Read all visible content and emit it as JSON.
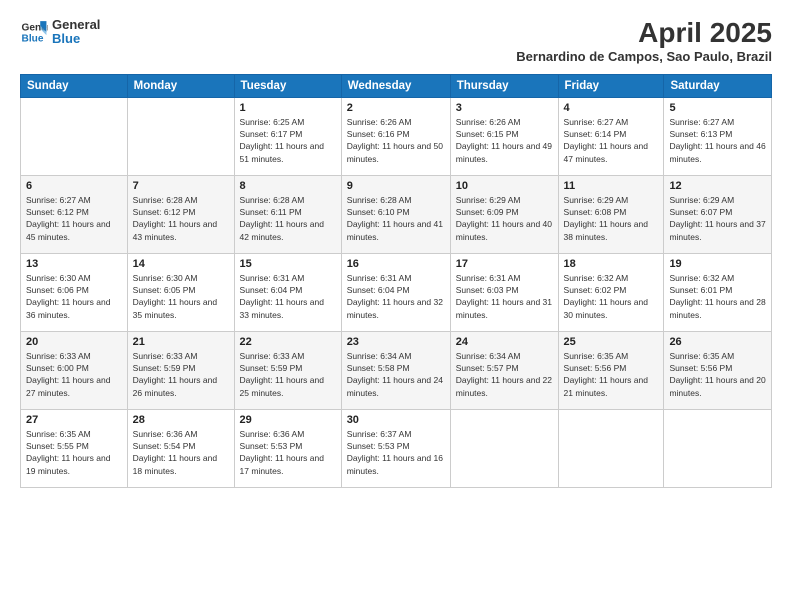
{
  "logo": {
    "line1": "General",
    "line2": "Blue"
  },
  "title": "April 2025",
  "subtitle": "Bernardino de Campos, Sao Paulo, Brazil",
  "days_of_week": [
    "Sunday",
    "Monday",
    "Tuesday",
    "Wednesday",
    "Thursday",
    "Friday",
    "Saturday"
  ],
  "weeks": [
    [
      {
        "day": "",
        "info": ""
      },
      {
        "day": "",
        "info": ""
      },
      {
        "day": "1",
        "info": "Sunrise: 6:25 AM\nSunset: 6:17 PM\nDaylight: 11 hours and 51 minutes."
      },
      {
        "day": "2",
        "info": "Sunrise: 6:26 AM\nSunset: 6:16 PM\nDaylight: 11 hours and 50 minutes."
      },
      {
        "day": "3",
        "info": "Sunrise: 6:26 AM\nSunset: 6:15 PM\nDaylight: 11 hours and 49 minutes."
      },
      {
        "day": "4",
        "info": "Sunrise: 6:27 AM\nSunset: 6:14 PM\nDaylight: 11 hours and 47 minutes."
      },
      {
        "day": "5",
        "info": "Sunrise: 6:27 AM\nSunset: 6:13 PM\nDaylight: 11 hours and 46 minutes."
      }
    ],
    [
      {
        "day": "6",
        "info": "Sunrise: 6:27 AM\nSunset: 6:12 PM\nDaylight: 11 hours and 45 minutes."
      },
      {
        "day": "7",
        "info": "Sunrise: 6:28 AM\nSunset: 6:12 PM\nDaylight: 11 hours and 43 minutes."
      },
      {
        "day": "8",
        "info": "Sunrise: 6:28 AM\nSunset: 6:11 PM\nDaylight: 11 hours and 42 minutes."
      },
      {
        "day": "9",
        "info": "Sunrise: 6:28 AM\nSunset: 6:10 PM\nDaylight: 11 hours and 41 minutes."
      },
      {
        "day": "10",
        "info": "Sunrise: 6:29 AM\nSunset: 6:09 PM\nDaylight: 11 hours and 40 minutes."
      },
      {
        "day": "11",
        "info": "Sunrise: 6:29 AM\nSunset: 6:08 PM\nDaylight: 11 hours and 38 minutes."
      },
      {
        "day": "12",
        "info": "Sunrise: 6:29 AM\nSunset: 6:07 PM\nDaylight: 11 hours and 37 minutes."
      }
    ],
    [
      {
        "day": "13",
        "info": "Sunrise: 6:30 AM\nSunset: 6:06 PM\nDaylight: 11 hours and 36 minutes."
      },
      {
        "day": "14",
        "info": "Sunrise: 6:30 AM\nSunset: 6:05 PM\nDaylight: 11 hours and 35 minutes."
      },
      {
        "day": "15",
        "info": "Sunrise: 6:31 AM\nSunset: 6:04 PM\nDaylight: 11 hours and 33 minutes."
      },
      {
        "day": "16",
        "info": "Sunrise: 6:31 AM\nSunset: 6:04 PM\nDaylight: 11 hours and 32 minutes."
      },
      {
        "day": "17",
        "info": "Sunrise: 6:31 AM\nSunset: 6:03 PM\nDaylight: 11 hours and 31 minutes."
      },
      {
        "day": "18",
        "info": "Sunrise: 6:32 AM\nSunset: 6:02 PM\nDaylight: 11 hours and 30 minutes."
      },
      {
        "day": "19",
        "info": "Sunrise: 6:32 AM\nSunset: 6:01 PM\nDaylight: 11 hours and 28 minutes."
      }
    ],
    [
      {
        "day": "20",
        "info": "Sunrise: 6:33 AM\nSunset: 6:00 PM\nDaylight: 11 hours and 27 minutes."
      },
      {
        "day": "21",
        "info": "Sunrise: 6:33 AM\nSunset: 5:59 PM\nDaylight: 11 hours and 26 minutes."
      },
      {
        "day": "22",
        "info": "Sunrise: 6:33 AM\nSunset: 5:59 PM\nDaylight: 11 hours and 25 minutes."
      },
      {
        "day": "23",
        "info": "Sunrise: 6:34 AM\nSunset: 5:58 PM\nDaylight: 11 hours and 24 minutes."
      },
      {
        "day": "24",
        "info": "Sunrise: 6:34 AM\nSunset: 5:57 PM\nDaylight: 11 hours and 22 minutes."
      },
      {
        "day": "25",
        "info": "Sunrise: 6:35 AM\nSunset: 5:56 PM\nDaylight: 11 hours and 21 minutes."
      },
      {
        "day": "26",
        "info": "Sunrise: 6:35 AM\nSunset: 5:56 PM\nDaylight: 11 hours and 20 minutes."
      }
    ],
    [
      {
        "day": "27",
        "info": "Sunrise: 6:35 AM\nSunset: 5:55 PM\nDaylight: 11 hours and 19 minutes."
      },
      {
        "day": "28",
        "info": "Sunrise: 6:36 AM\nSunset: 5:54 PM\nDaylight: 11 hours and 18 minutes."
      },
      {
        "day": "29",
        "info": "Sunrise: 6:36 AM\nSunset: 5:53 PM\nDaylight: 11 hours and 17 minutes."
      },
      {
        "day": "30",
        "info": "Sunrise: 6:37 AM\nSunset: 5:53 PM\nDaylight: 11 hours and 16 minutes."
      },
      {
        "day": "",
        "info": ""
      },
      {
        "day": "",
        "info": ""
      },
      {
        "day": "",
        "info": ""
      }
    ]
  ]
}
